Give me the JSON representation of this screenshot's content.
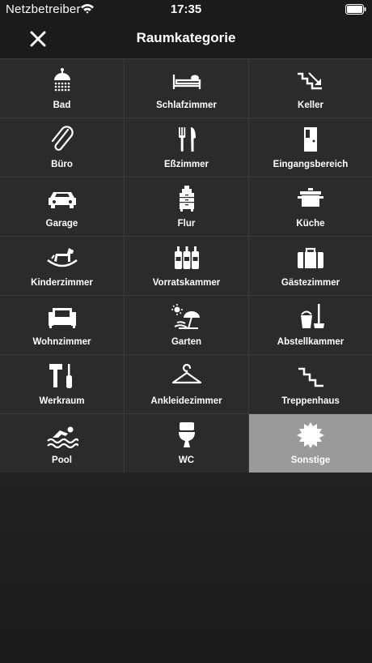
{
  "status_bar": {
    "carrier": "Netzbetreiber",
    "time": "17:35",
    "wifi_icon": "wifi-icon",
    "battery_icon": "battery-icon"
  },
  "nav": {
    "title": "Raumkategorie",
    "close_icon": "close-icon"
  },
  "rooms": [
    {
      "label": "Bad",
      "icon": "shower-icon"
    },
    {
      "label": "Schlafzimmer",
      "icon": "bed-icon"
    },
    {
      "label": "Keller",
      "icon": "stairs-down-icon"
    },
    {
      "label": "Büro",
      "icon": "paperclip-icon"
    },
    {
      "label": "Eßzimmer",
      "icon": "fork-knife-icon"
    },
    {
      "label": "Eingangsbereich",
      "icon": "door-icon"
    },
    {
      "label": "Garage",
      "icon": "car-icon"
    },
    {
      "label": "Flur",
      "icon": "dresser-icon"
    },
    {
      "label": "Küche",
      "icon": "pot-icon"
    },
    {
      "label": "Kinderzimmer",
      "icon": "rocking-horse-icon"
    },
    {
      "label": "Vorratskammer",
      "icon": "bottles-icon"
    },
    {
      "label": "Gästezimmer",
      "icon": "suitcase-icon"
    },
    {
      "label": "Wohnzimmer",
      "icon": "sofa-icon"
    },
    {
      "label": "Garten",
      "icon": "sun-umbrella-icon"
    },
    {
      "label": "Abstellkammer",
      "icon": "bucket-mop-icon"
    },
    {
      "label": "Werkraum",
      "icon": "hammer-screwdriver-icon"
    },
    {
      "label": "Ankleidezimmer",
      "icon": "hanger-icon"
    },
    {
      "label": "Treppenhaus",
      "icon": "stairs-icon"
    },
    {
      "label": "Pool",
      "icon": "swimmer-icon"
    },
    {
      "label": "WC",
      "icon": "toilet-icon"
    },
    {
      "label": "Sonstige",
      "icon": "starburst-icon",
      "selected": true
    }
  ],
  "colors": {
    "background": "#1d1d1d",
    "tile": "#2b2b2b",
    "tile_selected": "#9a9a9a",
    "divider": "#3c3c3c",
    "text": "#ffffff"
  }
}
